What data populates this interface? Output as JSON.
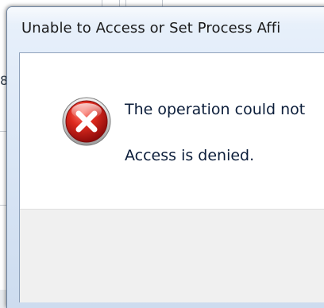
{
  "dialog": {
    "title": "Unable to Access or Set Process Affi",
    "message": "The operation could not",
    "detail": "Access is denied.",
    "icon": "error-icon"
  },
  "background": {
    "glyph": "8"
  },
  "colors": {
    "title_bar": "#dce8f7",
    "border": "#6e84a0",
    "footer": "#f0f0f0",
    "text": "#0b1d3a",
    "error_red": "#c8102e"
  }
}
